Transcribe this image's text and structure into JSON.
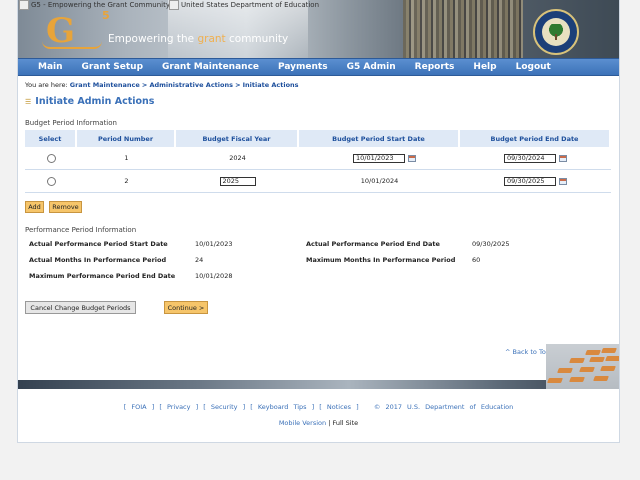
{
  "banner": {
    "logo_alt": "G5 - Empowering the Grant Community",
    "ed_alt": "United States Department of Education",
    "logo_letter": "G",
    "logo_sup": "5",
    "tagline_pre": "Empowering the ",
    "tagline_grant": "grant",
    "tagline_post": " community"
  },
  "nav": [
    "Main",
    "Grant Setup",
    "Grant Maintenance",
    "Payments",
    "G5 Admin",
    "Reports",
    "Help",
    "Logout"
  ],
  "breadcrumb": {
    "prefix": "You are here:",
    "items": [
      "Grant Maintenance",
      "Administrative Actions",
      "Initiate Actions"
    ],
    "sep": ">"
  },
  "page_title": "Initiate Admin Actions",
  "budget_section": "Budget Period Information",
  "table": {
    "headers": [
      "Select",
      "Period Number",
      "Budget Fiscal Year",
      "Budget Period Start Date",
      "Budget Period End Date"
    ],
    "rows": [
      {
        "period": "1",
        "fiscal_year": "2024",
        "start": "10/01/2023",
        "end": "09/30/2024"
      },
      {
        "period": "2",
        "fiscal_year": "2025",
        "start": "10/01/2024",
        "end": "09/30/2025"
      }
    ]
  },
  "buttons": {
    "add": "Add",
    "remove": "Remove",
    "cancel": "Cancel Change Budget Periods",
    "continue": "Continue >"
  },
  "performance_section": "Performance Period Information",
  "performance": {
    "actual_start_label": "Actual Performance Period Start Date",
    "actual_start": "10/01/2023",
    "actual_end_label": "Actual Performance Period End Date",
    "actual_end": "09/30/2025",
    "actual_months_label": "Actual Months In Performance Period",
    "actual_months": "24",
    "max_months_label": "Maximum Months In Performance Period",
    "max_months": "60",
    "max_end_label": "Maximum Performance Period End Date",
    "max_end": "10/01/2028"
  },
  "back_to_top": "^ Back to Top",
  "footer": {
    "links": [
      "FOIA",
      "Privacy",
      "Security",
      "Keyboard Tips",
      "Notices"
    ],
    "copyright": "© 2017 U.S. Department of Education",
    "mobile": "Mobile Version",
    "bar": "|",
    "full": "Full Site"
  }
}
